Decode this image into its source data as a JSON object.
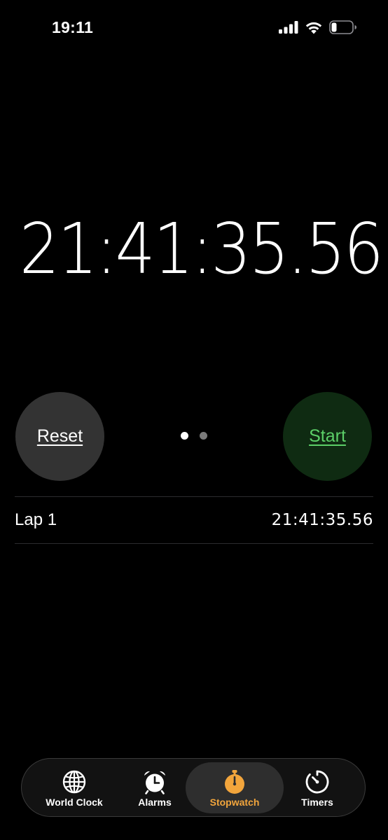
{
  "status_bar": {
    "time": "19:11",
    "icons": [
      "signal-icon",
      "wifi-icon",
      "battery-icon"
    ]
  },
  "stopwatch": {
    "display_time": "21:41:35.56",
    "reset_label": "Reset",
    "start_label": "Start",
    "page_count": 2,
    "active_page": 1
  },
  "laps": [
    {
      "label": "Lap 1",
      "time": "21:41:35.56"
    }
  ],
  "tab_bar": {
    "tabs": [
      {
        "label": "World Clock",
        "icon": "globe-icon"
      },
      {
        "label": "Alarms",
        "icon": "alarm-clock-icon"
      },
      {
        "label": "Stopwatch",
        "icon": "stopwatch-icon",
        "selected": true
      },
      {
        "label": "Timers",
        "icon": "timer-icon"
      }
    ]
  },
  "colors": {
    "background": "#000000",
    "reset_button": "#333333",
    "start_button_bg": "#0f2b12",
    "start_button_text": "#5ccf68",
    "selected_tab": "#f2a53c"
  }
}
